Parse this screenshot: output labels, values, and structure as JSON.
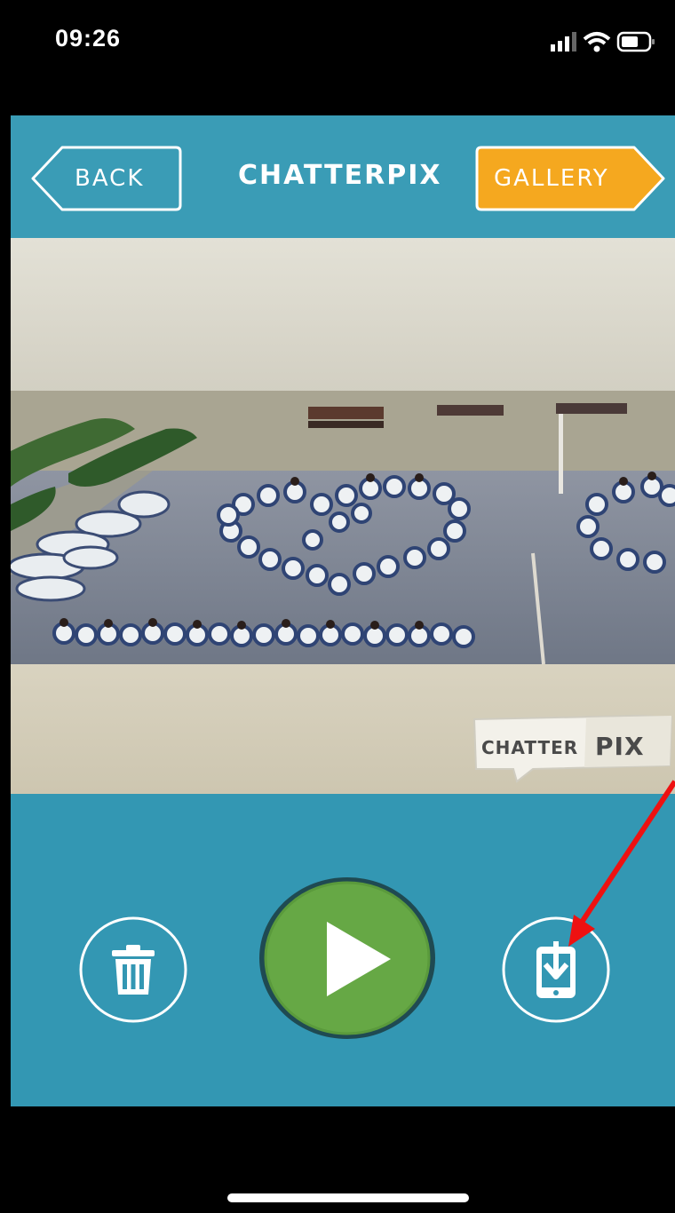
{
  "status_bar": {
    "time": "09:26",
    "icons": [
      "signal-icon",
      "wifi-icon",
      "battery-icon"
    ]
  },
  "header": {
    "back_label": "BACK",
    "title": "CHATTERPIX",
    "gallery_label": "GALLERY"
  },
  "photo": {
    "watermark_left": "CHATTER",
    "watermark_right": "PIX"
  },
  "controls": {
    "delete_icon": "trash-icon",
    "play_icon": "play-icon",
    "save_icon": "save-to-device-icon"
  },
  "colors": {
    "header_bg": "#3a9cb6",
    "panel_bg": "#3397b3",
    "gallery_orange": "#f5a81f",
    "play_green": "#66a845",
    "annotation_red": "#ee1111"
  }
}
